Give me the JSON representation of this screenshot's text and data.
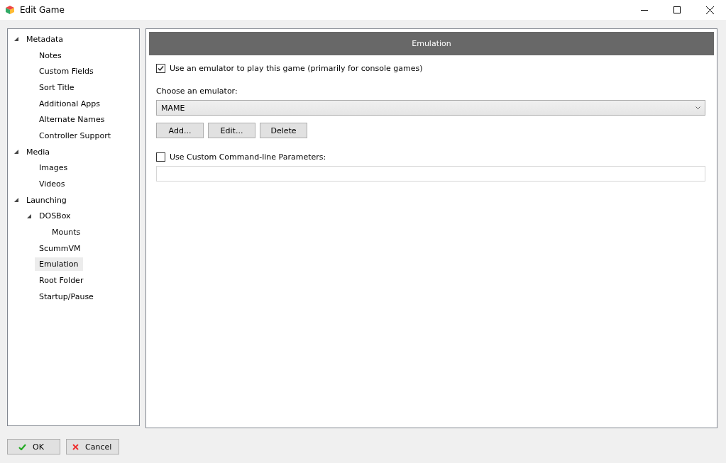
{
  "window": {
    "title": "Edit Game"
  },
  "tree": [
    {
      "label": "Metadata",
      "expanded": true,
      "selected": false,
      "children": [
        {
          "label": "Notes",
          "selected": false
        },
        {
          "label": "Custom Fields",
          "selected": false
        },
        {
          "label": "Sort Title",
          "selected": false
        },
        {
          "label": "Additional Apps",
          "selected": false
        },
        {
          "label": "Alternate Names",
          "selected": false
        },
        {
          "label": "Controller Support",
          "selected": false
        }
      ]
    },
    {
      "label": "Media",
      "expanded": true,
      "selected": false,
      "children": [
        {
          "label": "Images",
          "selected": false
        },
        {
          "label": "Videos",
          "selected": false
        }
      ]
    },
    {
      "label": "Launching",
      "expanded": true,
      "selected": false,
      "children": [
        {
          "label": "DOSBox",
          "expanded": true,
          "selected": false,
          "children": [
            {
              "label": "Mounts",
              "selected": false
            }
          ]
        },
        {
          "label": "ScummVM",
          "selected": false
        },
        {
          "label": "Emulation",
          "selected": true
        },
        {
          "label": "Root Folder",
          "selected": false
        },
        {
          "label": "Startup/Pause",
          "selected": false
        }
      ]
    }
  ],
  "panel": {
    "title": "Emulation",
    "use_emulator": {
      "label": "Use an emulator to play this game (primarily for console games)",
      "checked": true
    },
    "emulator_label": "Choose an emulator:",
    "emulator": {
      "value": "MAME"
    },
    "buttons": [
      "Add...",
      "Edit...",
      "Delete"
    ],
    "custom_params": {
      "label": "Use Custom Command-line Parameters:",
      "checked": false
    }
  },
  "footer": [
    {
      "kind": "ok",
      "label": "OK"
    },
    {
      "kind": "cancel",
      "label": "Cancel"
    }
  ]
}
